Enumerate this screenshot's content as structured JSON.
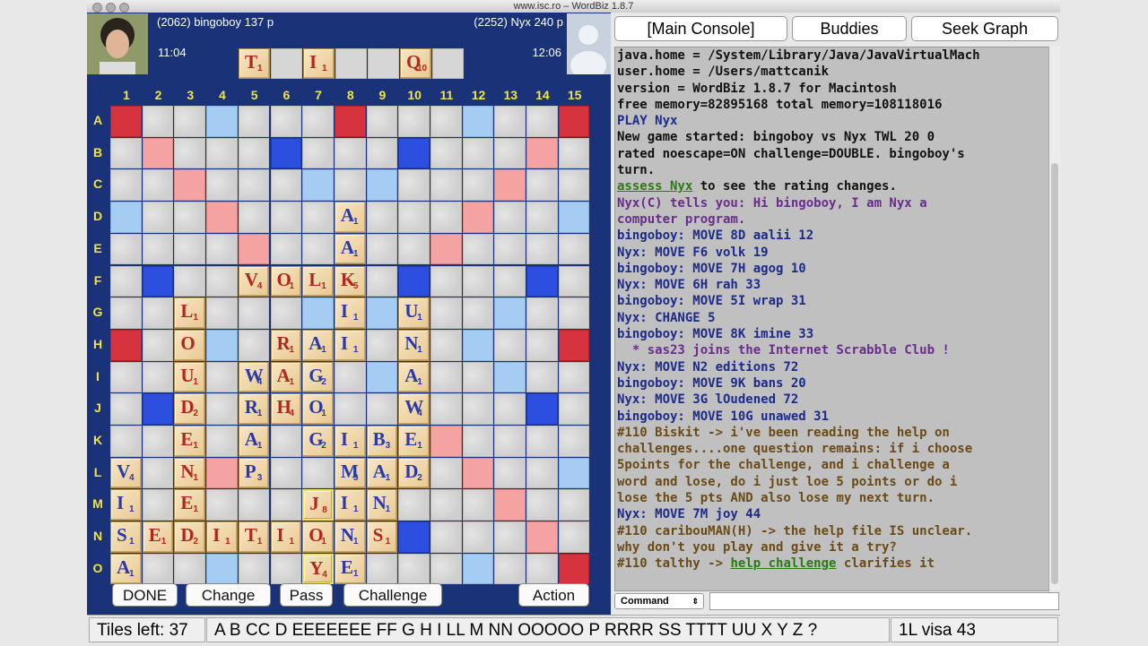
{
  "window": {
    "title": "www.isc.ro – WordBiz 1.8.7"
  },
  "players": {
    "left": {
      "label": "(2062) bingoboy  137 p",
      "clock": "11:04"
    },
    "right": {
      "label": "(2252) Nyx  240 p",
      "clock": "12:06"
    }
  },
  "rack": [
    {
      "letter": "T",
      "points": "1"
    },
    {
      "letter": "",
      "points": ""
    },
    {
      "letter": "I",
      "points": "1"
    },
    {
      "letter": "",
      "points": ""
    },
    {
      "letter": "",
      "points": ""
    },
    {
      "letter": "Q",
      "points": "10"
    },
    {
      "letter": "",
      "points": ""
    }
  ],
  "board": {
    "columns": [
      "1",
      "2",
      "3",
      "4",
      "5",
      "6",
      "7",
      "8",
      "9",
      "10",
      "11",
      "12",
      "13",
      "14",
      "15"
    ],
    "rows": [
      "A",
      "B",
      "C",
      "D",
      "E",
      "F",
      "G",
      "H",
      "I",
      "J",
      "K",
      "L",
      "M",
      "N",
      "O"
    ],
    "premium": {
      "tw": [
        [
          0,
          0
        ],
        [
          0,
          7
        ],
        [
          0,
          14
        ],
        [
          7,
          0
        ],
        [
          7,
          14
        ],
        [
          14,
          0
        ],
        [
          14,
          14
        ]
      ],
      "dw": [
        [
          1,
          1
        ],
        [
          1,
          13
        ],
        [
          2,
          2
        ],
        [
          2,
          12
        ],
        [
          3,
          3
        ],
        [
          3,
          11
        ],
        [
          4,
          4
        ],
        [
          4,
          10
        ],
        [
          10,
          4
        ],
        [
          10,
          10
        ],
        [
          11,
          3
        ],
        [
          11,
          11
        ],
        [
          12,
          2
        ],
        [
          12,
          12
        ],
        [
          13,
          1
        ],
        [
          13,
          13
        ]
      ],
      "tl": [
        [
          1,
          5
        ],
        [
          1,
          9
        ],
        [
          5,
          1
        ],
        [
          5,
          5
        ],
        [
          5,
          9
        ],
        [
          5,
          13
        ],
        [
          9,
          1
        ],
        [
          9,
          5
        ],
        [
          9,
          9
        ],
        [
          9,
          13
        ],
        [
          13,
          5
        ],
        [
          13,
          9
        ]
      ],
      "dl": [
        [
          0,
          3
        ],
        [
          0,
          11
        ],
        [
          2,
          6
        ],
        [
          2,
          8
        ],
        [
          3,
          0
        ],
        [
          3,
          14
        ],
        [
          6,
          2
        ],
        [
          6,
          6
        ],
        [
          6,
          8
        ],
        [
          6,
          12
        ],
        [
          7,
          3
        ],
        [
          7,
          11
        ],
        [
          8,
          2
        ],
        [
          8,
          6
        ],
        [
          8,
          8
        ],
        [
          8,
          12
        ],
        [
          11,
          0
        ],
        [
          11,
          14
        ],
        [
          12,
          6
        ],
        [
          12,
          8
        ],
        [
          14,
          3
        ],
        [
          14,
          11
        ]
      ]
    },
    "tiles": [
      {
        "r": 3,
        "c": 7,
        "letter": "A",
        "points": "1",
        "color": "blue"
      },
      {
        "r": 4,
        "c": 7,
        "letter": "A",
        "points": "1",
        "color": "blue"
      },
      {
        "r": 5,
        "c": 4,
        "letter": "V",
        "points": "4",
        "color": "red"
      },
      {
        "r": 5,
        "c": 5,
        "letter": "O",
        "points": "1",
        "color": "red"
      },
      {
        "r": 5,
        "c": 6,
        "letter": "L",
        "points": "1",
        "color": "red"
      },
      {
        "r": 5,
        "c": 7,
        "letter": "K",
        "points": "5",
        "color": "red"
      },
      {
        "r": 6,
        "c": 2,
        "letter": "L",
        "points": "1",
        "color": "red"
      },
      {
        "r": 6,
        "c": 7,
        "letter": "I",
        "points": "1",
        "color": "blue"
      },
      {
        "r": 6,
        "c": 9,
        "letter": "U",
        "points": "1",
        "color": "blue"
      },
      {
        "r": 7,
        "c": 2,
        "letter": "O",
        "points": "",
        "color": "red"
      },
      {
        "r": 7,
        "c": 5,
        "letter": "R",
        "points": "1",
        "color": "red"
      },
      {
        "r": 7,
        "c": 6,
        "letter": "A",
        "points": "1",
        "color": "blue"
      },
      {
        "r": 7,
        "c": 7,
        "letter": "I",
        "points": "1",
        "color": "blue"
      },
      {
        "r": 7,
        "c": 9,
        "letter": "N",
        "points": "1",
        "color": "blue"
      },
      {
        "r": 8,
        "c": 2,
        "letter": "U",
        "points": "1",
        "color": "red"
      },
      {
        "r": 8,
        "c": 4,
        "letter": "W",
        "points": "4",
        "color": "blue"
      },
      {
        "r": 8,
        "c": 5,
        "letter": "A",
        "points": "1",
        "color": "red"
      },
      {
        "r": 8,
        "c": 6,
        "letter": "G",
        "points": "2",
        "color": "blue"
      },
      {
        "r": 8,
        "c": 9,
        "letter": "A",
        "points": "1",
        "color": "blue"
      },
      {
        "r": 9,
        "c": 2,
        "letter": "D",
        "points": "2",
        "color": "red"
      },
      {
        "r": 9,
        "c": 4,
        "letter": "R",
        "points": "1",
        "color": "blue"
      },
      {
        "r": 9,
        "c": 5,
        "letter": "H",
        "points": "4",
        "color": "red"
      },
      {
        "r": 9,
        "c": 6,
        "letter": "O",
        "points": "1",
        "color": "blue"
      },
      {
        "r": 9,
        "c": 9,
        "letter": "W",
        "points": "4",
        "color": "blue"
      },
      {
        "r": 10,
        "c": 2,
        "letter": "E",
        "points": "1",
        "color": "red"
      },
      {
        "r": 10,
        "c": 4,
        "letter": "A",
        "points": "1",
        "color": "blue"
      },
      {
        "r": 10,
        "c": 6,
        "letter": "G",
        "points": "2",
        "color": "blue"
      },
      {
        "r": 10,
        "c": 7,
        "letter": "I",
        "points": "1",
        "color": "blue"
      },
      {
        "r": 10,
        "c": 8,
        "letter": "B",
        "points": "3",
        "color": "blue"
      },
      {
        "r": 10,
        "c": 9,
        "letter": "E",
        "points": "1",
        "color": "blue"
      },
      {
        "r": 11,
        "c": 0,
        "letter": "V",
        "points": "4",
        "color": "blue"
      },
      {
        "r": 11,
        "c": 2,
        "letter": "N",
        "points": "1",
        "color": "red"
      },
      {
        "r": 11,
        "c": 4,
        "letter": "P",
        "points": "3",
        "color": "blue"
      },
      {
        "r": 11,
        "c": 7,
        "letter": "M",
        "points": "3",
        "color": "blue"
      },
      {
        "r": 11,
        "c": 8,
        "letter": "A",
        "points": "1",
        "color": "blue"
      },
      {
        "r": 11,
        "c": 9,
        "letter": "D",
        "points": "2",
        "color": "blue"
      },
      {
        "r": 12,
        "c": 0,
        "letter": "I",
        "points": "1",
        "color": "blue"
      },
      {
        "r": 12,
        "c": 2,
        "letter": "E",
        "points": "1",
        "color": "red"
      },
      {
        "r": 12,
        "c": 6,
        "letter": "J",
        "points": "8",
        "color": "red",
        "hl": true
      },
      {
        "r": 12,
        "c": 7,
        "letter": "I",
        "points": "1",
        "color": "blue"
      },
      {
        "r": 12,
        "c": 8,
        "letter": "N",
        "points": "1",
        "color": "blue"
      },
      {
        "r": 13,
        "c": 0,
        "letter": "S",
        "points": "1",
        "color": "blue"
      },
      {
        "r": 13,
        "c": 1,
        "letter": "E",
        "points": "1",
        "color": "red"
      },
      {
        "r": 13,
        "c": 2,
        "letter": "D",
        "points": "2",
        "color": "red"
      },
      {
        "r": 13,
        "c": 3,
        "letter": "I",
        "points": "1",
        "color": "red"
      },
      {
        "r": 13,
        "c": 4,
        "letter": "T",
        "points": "1",
        "color": "red"
      },
      {
        "r": 13,
        "c": 5,
        "letter": "I",
        "points": "1",
        "color": "red"
      },
      {
        "r": 13,
        "c": 6,
        "letter": "O",
        "points": "1",
        "color": "red"
      },
      {
        "r": 13,
        "c": 7,
        "letter": "N",
        "points": "1",
        "color": "blue"
      },
      {
        "r": 13,
        "c": 8,
        "letter": "S",
        "points": "1",
        "color": "red"
      },
      {
        "r": 14,
        "c": 0,
        "letter": "A",
        "points": "1",
        "color": "blue"
      },
      {
        "r": 14,
        "c": 6,
        "letter": "Y",
        "points": "4",
        "color": "red",
        "hl": true
      },
      {
        "r": 14,
        "c": 7,
        "letter": "E",
        "points": "1",
        "color": "blue"
      }
    ]
  },
  "buttons": {
    "done": "DONE",
    "change": "Change",
    "pass": "Pass",
    "challenge": "Challenge",
    "action": "Action"
  },
  "tabs": {
    "main": "[Main Console]",
    "buddies": "Buddies",
    "seek": "Seek Graph"
  },
  "colors": {
    "black": "#111111",
    "navy": "#1c2a88",
    "purple": "#6a2c8c",
    "brown": "#6b4a16",
    "green": "#2a7a14"
  },
  "console": [
    {
      "segs": [
        {
          "t": "java.home = /System/Library/Java/JavaVirtualMach",
          "c": "black"
        }
      ]
    },
    {
      "segs": [
        {
          "t": "user.home = /Users/mattcanik",
          "c": "black"
        }
      ]
    },
    {
      "segs": [
        {
          "t": "version = WordBiz 1.8.7 for Macintosh",
          "c": "black"
        }
      ]
    },
    {
      "segs": [
        {
          "t": "free memory=82895168 total memory=108118016",
          "c": "black"
        }
      ]
    },
    {
      "segs": [
        {
          "t": "PLAY Nyx",
          "c": "navy"
        }
      ]
    },
    {
      "segs": [
        {
          "t": "New game started: bingoboy vs Nyx TWL 20 0",
          "c": "black"
        }
      ]
    },
    {
      "segs": [
        {
          "t": "rated noescape=ON challenge=DOUBLE. bingoboy's",
          "c": "black"
        }
      ]
    },
    {
      "segs": [
        {
          "t": "turn.",
          "c": "black"
        }
      ]
    },
    {
      "segs": [
        {
          "t": "assess Nyx",
          "c": "green",
          "u": true
        },
        {
          "t": " to see the rating changes.",
          "c": "black"
        }
      ]
    },
    {
      "segs": [
        {
          "t": "Nyx(C) tells you: Hi bingoboy, I am Nyx a",
          "c": "purple"
        }
      ]
    },
    {
      "segs": [
        {
          "t": "computer program.",
          "c": "purple"
        }
      ]
    },
    {
      "segs": [
        {
          "t": "bingoboy: MOVE 8D aalii 12",
          "c": "navy"
        }
      ]
    },
    {
      "segs": [
        {
          "t": "Nyx: MOVE F6 volk 19",
          "c": "navy"
        }
      ]
    },
    {
      "segs": [
        {
          "t": "bingoboy: MOVE 7H agog 10",
          "c": "navy"
        }
      ]
    },
    {
      "segs": [
        {
          "t": "Nyx: MOVE 6H rah 33",
          "c": "navy"
        }
      ]
    },
    {
      "segs": [
        {
          "t": "bingoboy: MOVE 5I wrap 31",
          "c": "navy"
        }
      ]
    },
    {
      "segs": [
        {
          "t": "Nyx: CHANGE 5",
          "c": "navy"
        }
      ]
    },
    {
      "segs": [
        {
          "t": "bingoboy: MOVE 8K imine 33",
          "c": "navy"
        }
      ]
    },
    {
      "segs": [
        {
          "t": "  * sas23 joins the Internet Scrabble Club !",
          "c": "purple"
        }
      ]
    },
    {
      "segs": [
        {
          "t": "Nyx: MOVE N2 editions 72",
          "c": "navy"
        }
      ]
    },
    {
      "segs": [
        {
          "t": "bingoboy: MOVE 9K bans 20",
          "c": "navy"
        }
      ]
    },
    {
      "segs": [
        {
          "t": "Nyx: MOVE 3G lOudened 72",
          "c": "navy"
        }
      ]
    },
    {
      "segs": [
        {
          "t": "bingoboy: MOVE 10G unawed 31",
          "c": "navy"
        }
      ]
    },
    {
      "segs": [
        {
          "t": "#110 Biskit -> i've been reading the help on",
          "c": "brown"
        }
      ]
    },
    {
      "segs": [
        {
          "t": "challenges....one question remains: if i choose",
          "c": "brown"
        }
      ]
    },
    {
      "segs": [
        {
          "t": "5points for the challenge, and i challenge a",
          "c": "brown"
        }
      ]
    },
    {
      "segs": [
        {
          "t": "word and lose, do i just loe 5 points or do i",
          "c": "brown"
        }
      ]
    },
    {
      "segs": [
        {
          "t": "lose the 5 pts AND also lose my next turn.",
          "c": "brown"
        }
      ]
    },
    {
      "segs": [
        {
          "t": "Nyx: MOVE 7M joy 44",
          "c": "navy"
        }
      ]
    },
    {
      "segs": [
        {
          "t": "#110 caribouMAN(H) -> the help file IS unclear.",
          "c": "brown"
        }
      ]
    },
    {
      "segs": [
        {
          "t": "why don't you play and give it a try?",
          "c": "brown"
        }
      ]
    },
    {
      "segs": [
        {
          "t": "#110 talthy -> ",
          "c": "brown"
        },
        {
          "t": "help challenge",
          "c": "green",
          "u": true
        },
        {
          "t": " clarifies it",
          "c": "brown"
        }
      ]
    }
  ],
  "command": {
    "select": "Command",
    "input": ""
  },
  "status": {
    "tiles_left": "Tiles left: 37",
    "unseen": "A B CC D EEEEEEE FF G H I LL M NN OOOOO P RRRR SS TTTT UU X Y Z ?",
    "right": "1L visa 43"
  }
}
